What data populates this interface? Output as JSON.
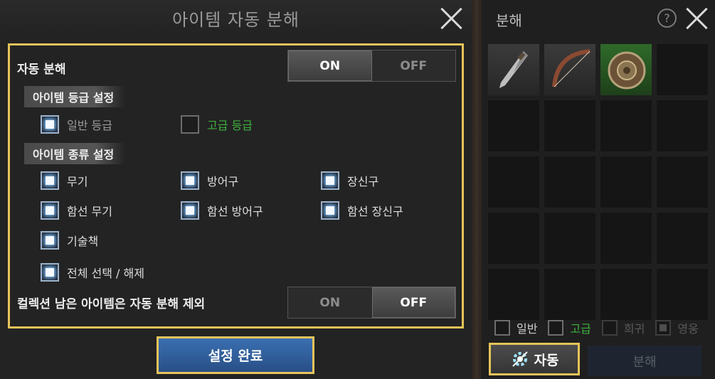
{
  "dialog": {
    "title": "아이템 자동 분해",
    "auto_label": "자동 분해",
    "toggle_on": "ON",
    "toggle_off": "OFF",
    "grade_section": "아이템 등급 설정",
    "grade_normal": "일반 등급",
    "grade_high": "고급 등급",
    "type_section": "아이템 종류 설정",
    "types": {
      "weapon": "무기",
      "armor": "방어구",
      "accessory": "장신구",
      "ship_weapon": "함선 무기",
      "ship_armor": "함선 방어구",
      "ship_accessory": "함선 장신구",
      "skillbook": "기술책",
      "select_all": "전체 선택 / 해제"
    },
    "collection_label": "컬렉션 남은 아이템은 자동 분해 제외",
    "done_button": "설정 완료"
  },
  "side": {
    "title": "분해",
    "help": "?",
    "filters": [
      "일반",
      "고급",
      "희귀",
      "영웅"
    ],
    "auto_button": "자동",
    "decompose_button": "분해"
  },
  "colors": {
    "highlight": "#e6c35a",
    "high_grade": "#3fb13f",
    "button_blue": "#3a6fb1"
  }
}
